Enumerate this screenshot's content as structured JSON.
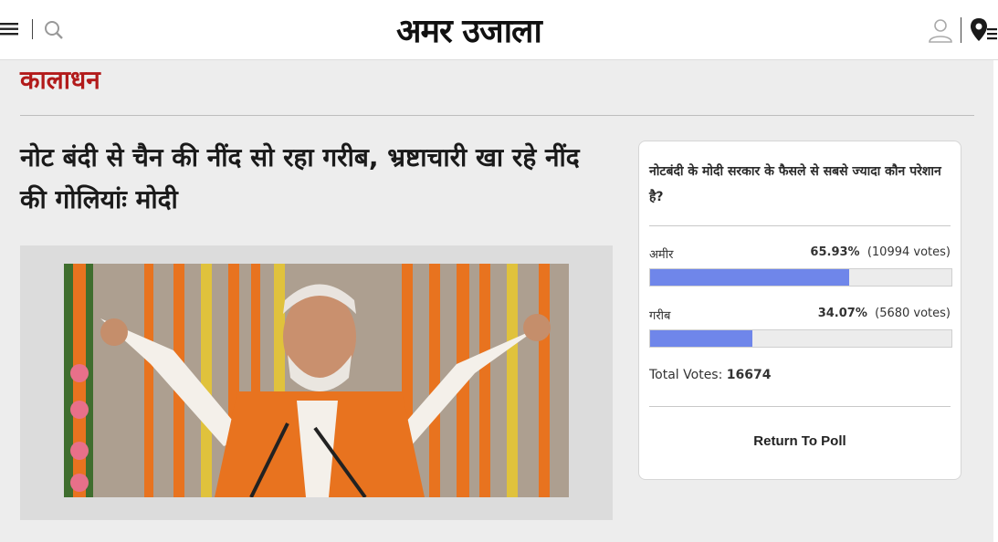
{
  "header": {
    "logo_text": "अमर उजाला",
    "icons": [
      "menu-icon",
      "search-icon",
      "user-icon",
      "location-icon"
    ]
  },
  "category": "कालाधन",
  "headline": "नोट बंदी से चैन की नींद सो रहा गरीब, भ्रष्टाचारी खा रहे नींद की गोलियांः मोदी",
  "poll": {
    "question": "नोटबंदी के मोदी सरकार के फैसले से सबसे ज्यादा कौन परेशान है?",
    "options": [
      {
        "label": "अमीर",
        "percent": "65.93%",
        "votes": "(10994 votes)",
        "fraction": 0.6593
      },
      {
        "label": "गरीब",
        "percent": "34.07%",
        "votes": "(5680 votes)",
        "fraction": 0.3407
      }
    ],
    "total_label": "Total Votes:",
    "total_value": "16674",
    "return_label": "Return To Poll",
    "bar_color": "#6f86ea"
  },
  "colors": {
    "category": "#b21a1a",
    "background": "#ededed"
  }
}
